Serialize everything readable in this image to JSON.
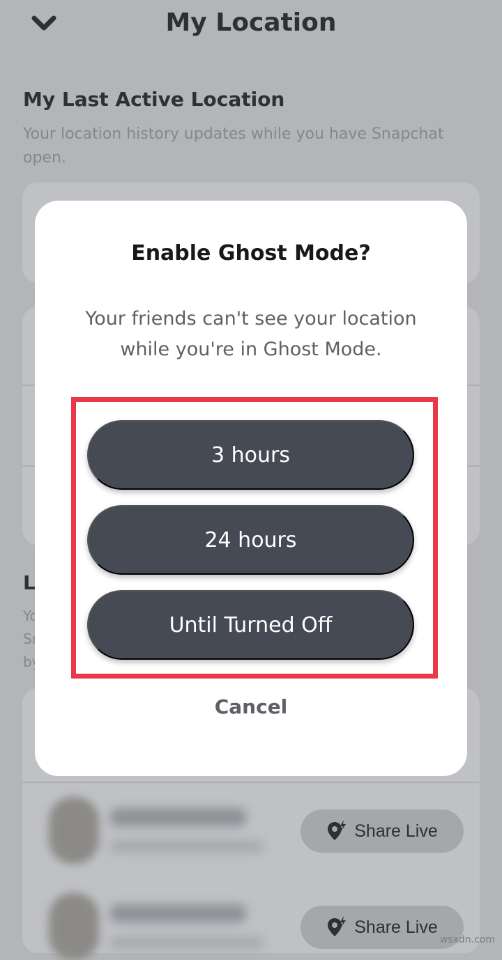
{
  "header": {
    "title": "My Location"
  },
  "last_active": {
    "title": "My Last Active Location",
    "description": "Your location history updates while you have Snapchat open."
  },
  "partial_section": {
    "title_fragment": "L",
    "lines": [
      "Yo",
      "Sr",
      "by"
    ]
  },
  "friends": [
    {
      "share_label": "Share Live"
    },
    {
      "share_label": "Share Live"
    }
  ],
  "modal": {
    "title": "Enable Ghost Mode?",
    "message": "Your friends can't see your location while you're in Ghost Mode.",
    "options": [
      "3 hours",
      "24 hours",
      "Until Turned Off"
    ],
    "cancel_label": "Cancel"
  },
  "colors": {
    "highlight": "#e8384a",
    "button": "#454a54"
  },
  "watermark": "wsxdn.com"
}
